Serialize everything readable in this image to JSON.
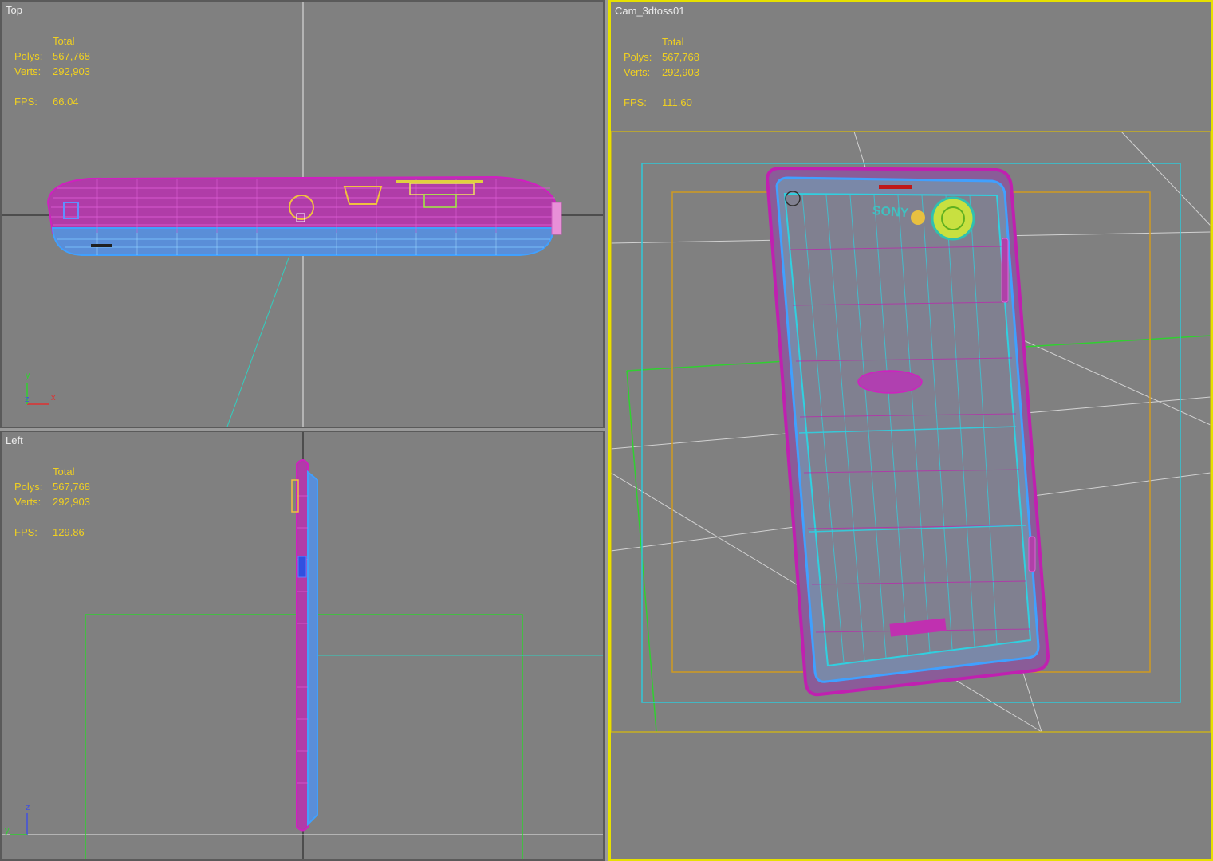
{
  "viewports": {
    "top": {
      "label": "Top",
      "stats": {
        "header": "Total",
        "polys_label": "Polys:",
        "polys": "567,768",
        "verts_label": "Verts:",
        "verts": "292,903",
        "fps_label": "FPS:",
        "fps": "66.04"
      },
      "axis": {
        "x": "x",
        "y": "y",
        "z": "z"
      }
    },
    "left": {
      "label": "Left",
      "stats": {
        "header": "Total",
        "polys_label": "Polys:",
        "polys": "567,768",
        "verts_label": "Verts:",
        "verts": "292,903",
        "fps_label": "FPS:",
        "fps": "129.86"
      },
      "axis": {
        "y": "y",
        "z": "z"
      }
    },
    "camera": {
      "label": "Cam_3dtoss01",
      "stats": {
        "header": "Total",
        "polys_label": "Polys:",
        "polys": "567,768",
        "verts_label": "Verts:",
        "verts": "292,903",
        "fps_label": "FPS:",
        "fps": "111.60"
      },
      "brand_text": "SONY",
      "active": true
    }
  },
  "colors": {
    "viewport_bg": "#808080",
    "stats_text": "#f0d020",
    "label_text": "#ececec",
    "active_border": "#e6e000",
    "wire_magenta": "#c020b0",
    "wire_blue": "#40a0ff",
    "wire_cyan": "#30d0e0",
    "safe_frame_orange": "#d09a20",
    "safe_frame_cyan": "#30c8d8",
    "safe_frame_yellow": "#c8b020",
    "grid_green": "#30d030"
  }
}
